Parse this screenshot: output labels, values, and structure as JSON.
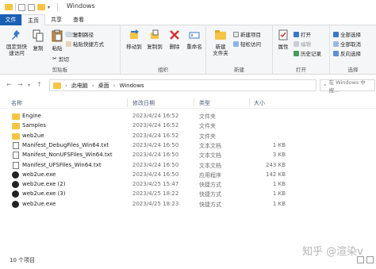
{
  "window": {
    "title": "Windows"
  },
  "tabs": [
    "文件",
    "主页",
    "共享",
    "查看"
  ],
  "ribbon": {
    "clipboard": {
      "label": "剪贴板",
      "pin": "固定到快\n速访问",
      "copy": "复制",
      "paste": "粘贴",
      "cut": "剪切",
      "copy_path": "复制路径",
      "paste_shortcut": "粘贴快捷方式"
    },
    "organize": {
      "label": "组织",
      "move_to": "移动到",
      "copy_to": "复制到",
      "delete": "删除",
      "rename": "重命名"
    },
    "new": {
      "label": "新建",
      "new_folder": "新建\n文件夹",
      "new_item": "新建项目",
      "easy_access": "轻松访问"
    },
    "open": {
      "label": "打开",
      "properties": "属性",
      "open": "打开",
      "edit": "编辑",
      "history": "历史记录"
    },
    "select": {
      "label": "选择",
      "select_all": "全部选择",
      "select_none": "全部取消",
      "invert": "反向选择"
    }
  },
  "address": {
    "path": [
      "此电脑",
      "桌面",
      "Windows"
    ],
    "search_placeholder": "在 Windows 中搜..."
  },
  "columns": {
    "name": "名称",
    "date": "修改日期",
    "type": "类型",
    "size": "大小"
  },
  "files": [
    {
      "name": "Engine",
      "date": "2023/4/24 16:52",
      "type": "文件夹",
      "size": "",
      "kind": "folder"
    },
    {
      "name": "Samples",
      "date": "2023/4/24 16:52",
      "type": "文件夹",
      "size": "",
      "kind": "folder"
    },
    {
      "name": "web2ue",
      "date": "2023/4/24 16:52",
      "type": "文件夹",
      "size": "",
      "kind": "folder"
    },
    {
      "name": "Manifest_DebugFiles_Win64.txt",
      "date": "2023/4/24 16:50",
      "type": "文本文档",
      "size": "1 KB",
      "kind": "txt"
    },
    {
      "name": "Manifest_NonUFSFiles_Win64.txt",
      "date": "2023/4/24 16:50",
      "type": "文本文档",
      "size": "3 KB",
      "kind": "txt"
    },
    {
      "name": "Manifest_UFSFiles_Win64.txt",
      "date": "2023/4/24 16:50",
      "type": "文本文档",
      "size": "243 KB",
      "kind": "txt"
    },
    {
      "name": "web2ue.exe",
      "date": "2023/4/24 16:50",
      "type": "应用程序",
      "size": "142 KB",
      "kind": "exe"
    },
    {
      "name": "web2ue.exe (2)",
      "date": "2023/4/25 15:47",
      "type": "快捷方式",
      "size": "1 KB",
      "kind": "exe"
    },
    {
      "name": "web2ue.exe (3)",
      "date": "2023/4/25 18:22",
      "type": "快捷方式",
      "size": "1 KB",
      "kind": "exe"
    },
    {
      "name": "web2ue.exe",
      "date": "2023/4/25 18:23",
      "type": "快捷方式",
      "size": "1 KB",
      "kind": "exe"
    }
  ],
  "status": {
    "count": "10 个项目"
  },
  "watermark": "知乎 @渲染v"
}
